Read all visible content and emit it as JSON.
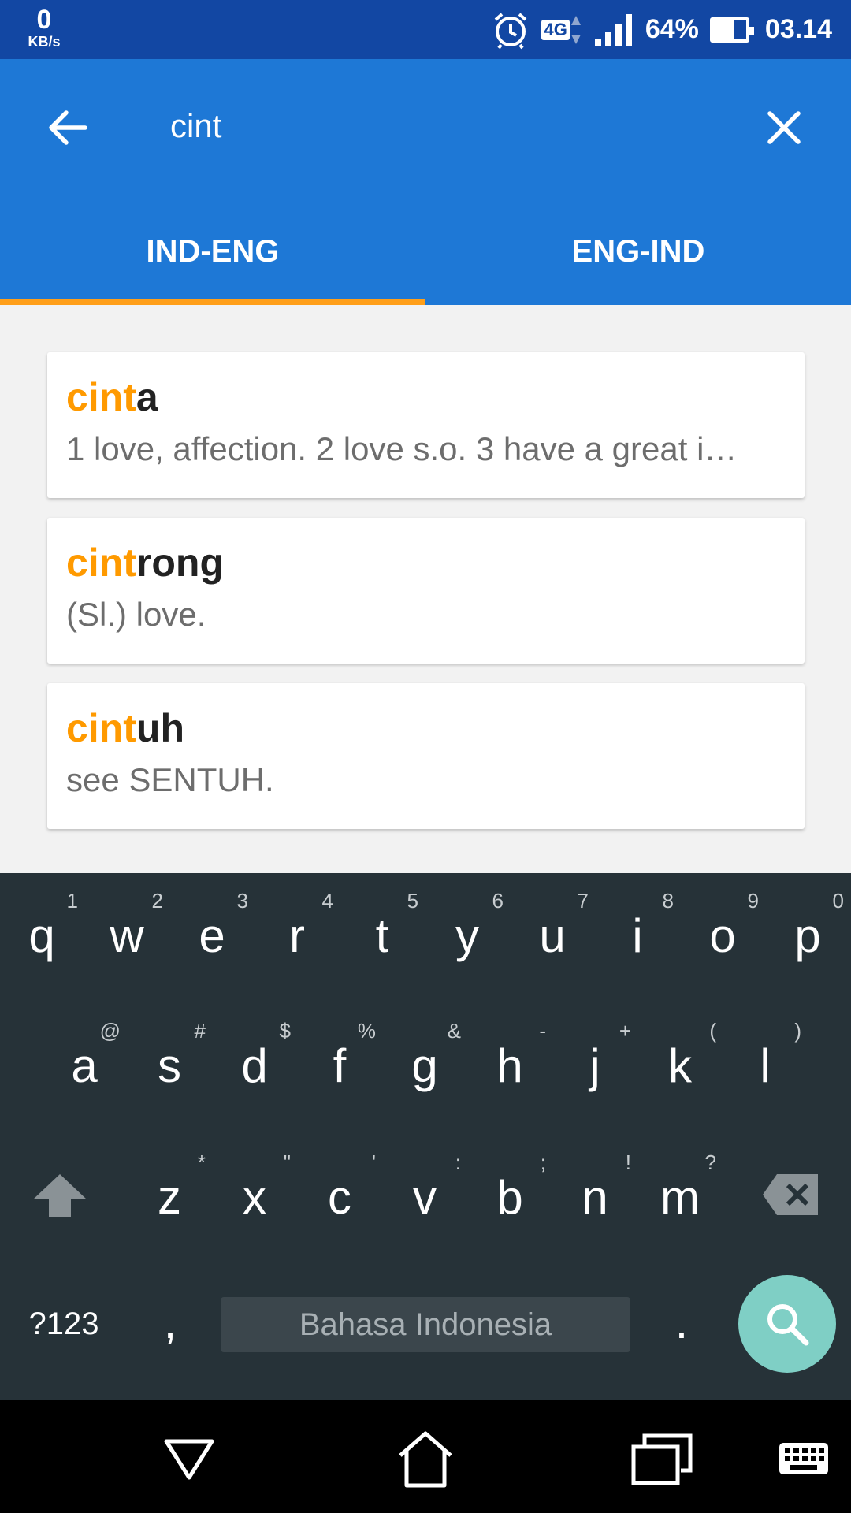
{
  "status_bar": {
    "net_speed_value": "0",
    "net_speed_unit": "KB/s",
    "network_type": "4G",
    "battery_percent": "64%",
    "battery_level": 0.64,
    "time": "03.14",
    "icons": [
      "alarm-icon",
      "network-4g-icon",
      "signal-icon",
      "battery-icon"
    ]
  },
  "app_bar": {
    "search_value": "cint",
    "tabs": [
      {
        "label": "IND-ENG",
        "active": true
      },
      {
        "label": "ENG-IND",
        "active": false
      }
    ],
    "accent_color": "#ff9f1a",
    "primary_color": "#1e78d6"
  },
  "results": [
    {
      "match": "cint",
      "rest": "a",
      "definition": "1 love, affection. 2 love s.o. 3 have a great i…"
    },
    {
      "match": "cint",
      "rest": "rong",
      "definition": "(Sl.) love."
    },
    {
      "match": "cint",
      "rest": "uh",
      "definition": "see  SENTUH."
    }
  ],
  "keyboard": {
    "row1": [
      {
        "k": "q",
        "h": "1"
      },
      {
        "k": "w",
        "h": "2"
      },
      {
        "k": "e",
        "h": "3"
      },
      {
        "k": "r",
        "h": "4"
      },
      {
        "k": "t",
        "h": "5"
      },
      {
        "k": "y",
        "h": "6"
      },
      {
        "k": "u",
        "h": "7"
      },
      {
        "k": "i",
        "h": "8"
      },
      {
        "k": "o",
        "h": "9"
      },
      {
        "k": "p",
        "h": "0"
      }
    ],
    "row2": [
      {
        "k": "a",
        "h": "@"
      },
      {
        "k": "s",
        "h": "#"
      },
      {
        "k": "d",
        "h": "$"
      },
      {
        "k": "f",
        "h": "%"
      },
      {
        "k": "g",
        "h": "&"
      },
      {
        "k": "h",
        "h": "-"
      },
      {
        "k": "j",
        "h": "+"
      },
      {
        "k": "k",
        "h": "("
      },
      {
        "k": "l",
        "h": ")"
      }
    ],
    "row3": [
      {
        "k": "z",
        "h": "*"
      },
      {
        "k": "x",
        "h": "\""
      },
      {
        "k": "c",
        "h": "'"
      },
      {
        "k": "v",
        "h": ":"
      },
      {
        "k": "b",
        "h": ";"
      },
      {
        "k": "n",
        "h": "!"
      },
      {
        "k": "m",
        "h": "?"
      }
    ],
    "symbols_label": "?123",
    "comma_label": ",",
    "space_label": "Bahasa Indonesia",
    "period_label": "."
  }
}
